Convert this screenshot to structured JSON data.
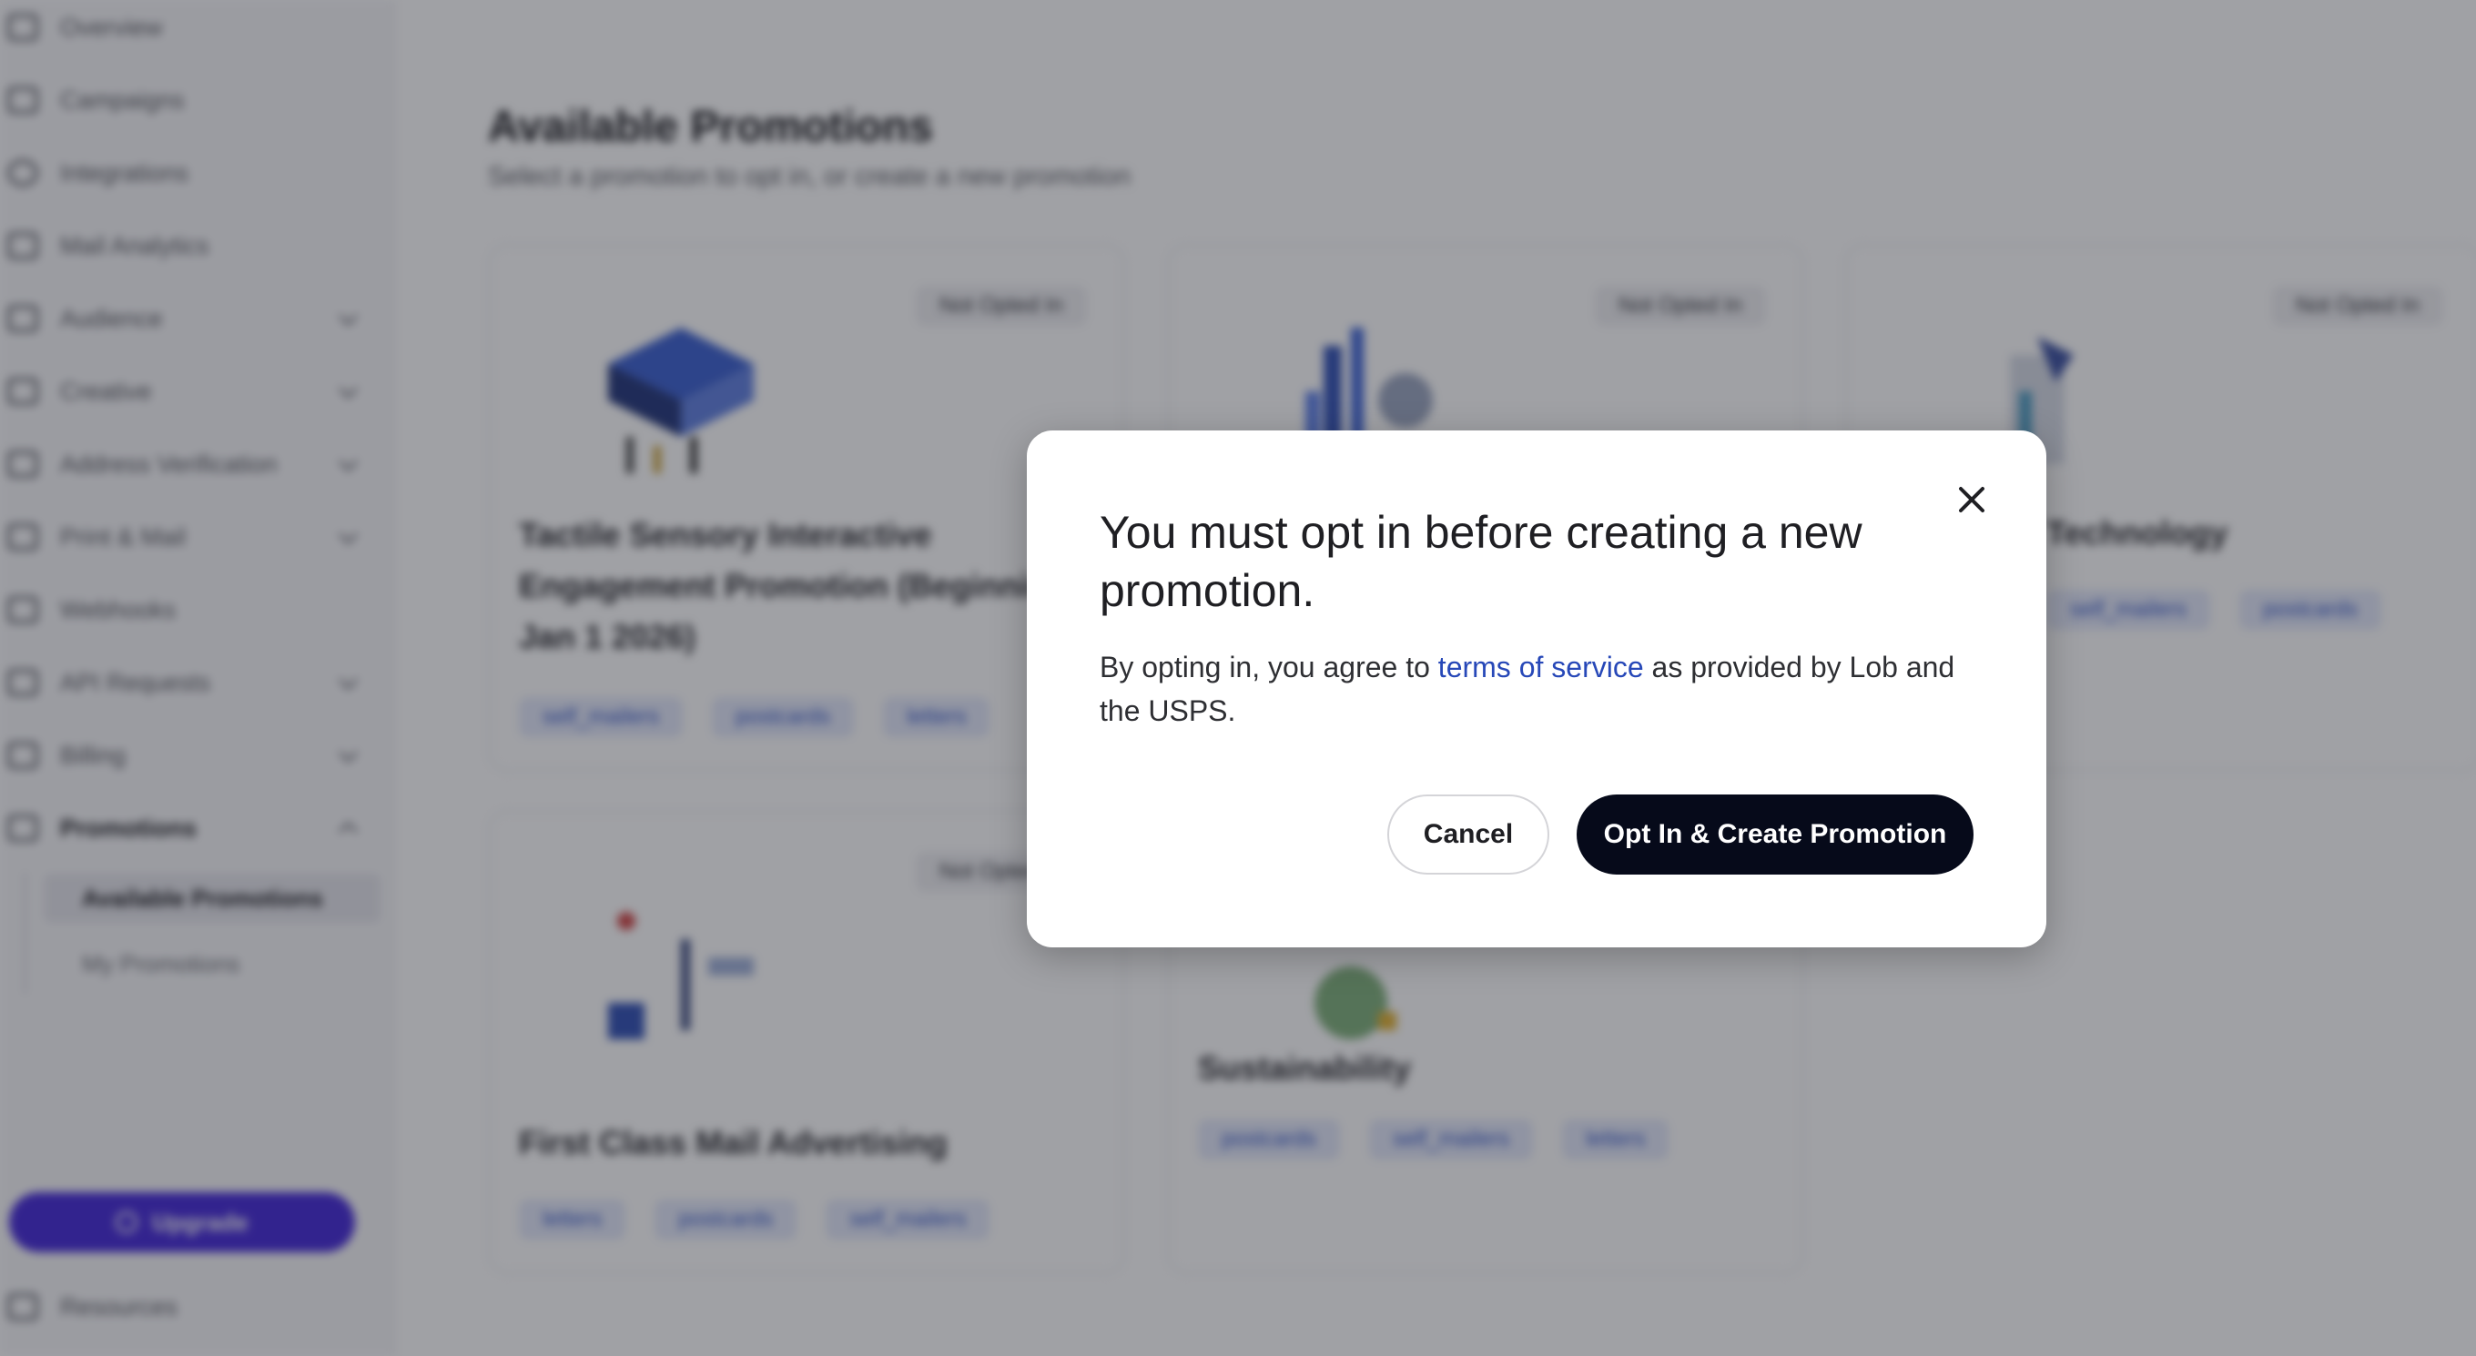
{
  "sidebar": {
    "items": [
      {
        "label": "Overview",
        "icon": "grid-icon",
        "expandable": false
      },
      {
        "label": "Campaigns",
        "icon": "megaphone-icon",
        "expandable": false
      },
      {
        "label": "Integrations",
        "icon": "plug-icon",
        "expandable": false
      },
      {
        "label": "Mail Analytics",
        "icon": "chart-icon",
        "expandable": false
      },
      {
        "label": "Audience",
        "icon": "users-icon",
        "expandable": true
      },
      {
        "label": "Creative",
        "icon": "image-icon",
        "expandable": true
      },
      {
        "label": "Address Verification",
        "icon": "pin-icon",
        "expandable": true
      },
      {
        "label": "Print & Mail",
        "icon": "envelope-icon",
        "expandable": true
      },
      {
        "label": "Webhooks",
        "icon": "webhook-icon",
        "expandable": false
      },
      {
        "label": "API Requests",
        "icon": "api-icon",
        "expandable": true
      },
      {
        "label": "Billing",
        "icon": "card-icon",
        "expandable": true
      },
      {
        "label": "Promotions",
        "icon": "tag-icon",
        "expandable": true,
        "expanded": true
      }
    ],
    "promotions_sub": [
      "Available Promotions",
      "My Promotions"
    ],
    "upgrade_label": "Upgrade",
    "resources_label": "Resources"
  },
  "main": {
    "title": "Available Promotions",
    "subtitle": "Select a promotion to opt in, or create a new promotion"
  },
  "cards": [
    {
      "status": "Not Opted In",
      "title": "Tactile Sensory Interactive Engagement Promotion (Beginning Jan 1 2026)",
      "tags": [
        "self_mailers",
        "postcards",
        "letters"
      ]
    },
    {
      "status": "Not Opted In",
      "title": "",
      "tags": []
    },
    {
      "status": "Not Opted In",
      "title": "Technology",
      "tags": [
        "self_mailers",
        "postcards"
      ]
    },
    {
      "status": "Not Opted In",
      "title": "First Class Mail Advertising",
      "tags": [
        "letters",
        "postcards",
        "self_mailers"
      ]
    },
    {
      "status": "",
      "title": "Sustainability",
      "tags": [
        "postcards",
        "self_mailers",
        "letters"
      ]
    }
  ],
  "modal": {
    "title": "You must opt in before creating a new promotion.",
    "body_prefix": "By opting in, you agree to ",
    "link_text": "terms of service",
    "body_suffix": " as provided by Lob and the USPS.",
    "cancel_label": "Cancel",
    "confirm_label": "Opt In & Create Promotion",
    "close_icon": "close-icon"
  },
  "colors": {
    "accent": "#4327d8",
    "link": "#2748b8",
    "primary_button": "#060a1a",
    "tag_bg": "#e4e9fb",
    "tag_text": "#3557c8"
  }
}
